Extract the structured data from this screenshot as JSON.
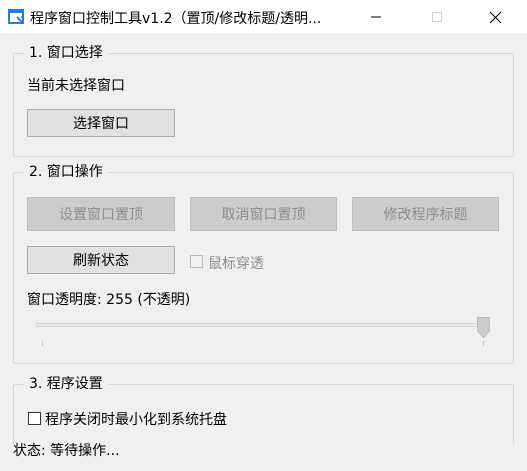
{
  "window": {
    "title": "程序窗口控制工具v1.2（置顶/修改标题/透明...",
    "minimize_icon": "minimize-icon",
    "maximize_icon": "maximize-icon",
    "close_icon": "close-icon",
    "accent_color": "#2b7bd8"
  },
  "group_select": {
    "title": "1. 窗口选择",
    "current_text": "当前未选择窗口",
    "select_button": "选择窗口"
  },
  "group_operate": {
    "title": "2. 窗口操作",
    "pin_button": "设置窗口置顶",
    "unpin_button": "取消窗口置顶",
    "rename_button": "修改程序标题",
    "refresh_button": "刷新状态",
    "click_through_label": "鼠标穿透",
    "click_through_checked": false,
    "click_through_enabled": false,
    "opacity_label": "窗口透明度: 255 (不透明)",
    "opacity_value": 255,
    "opacity_max": 255
  },
  "group_settings": {
    "title": "3. 程序设置",
    "tray_label": "程序关闭时最小化到系统托盘",
    "tray_checked": false
  },
  "status": {
    "text": "状态: 等待操作..."
  }
}
